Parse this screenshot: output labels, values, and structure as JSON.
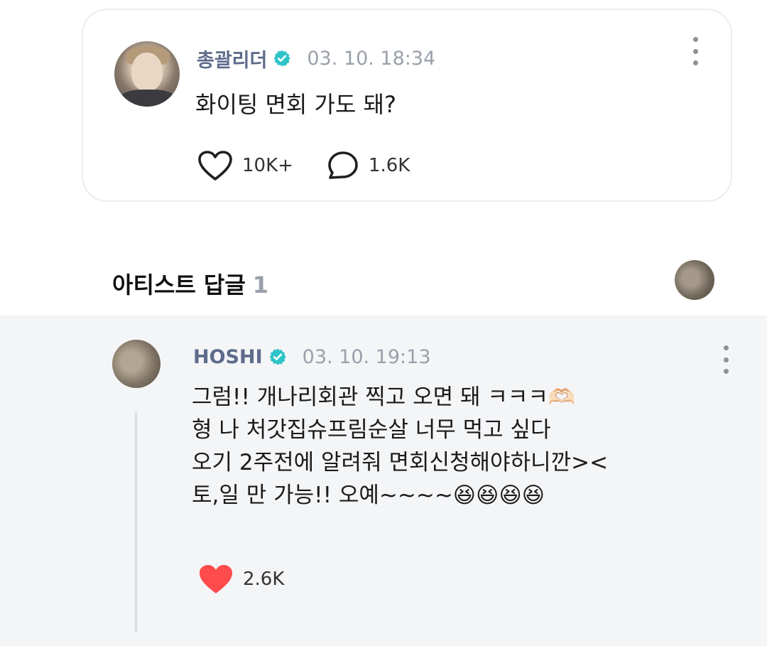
{
  "post": {
    "author": "총괄리더",
    "timestamp": "03. 10. 18:34",
    "text": "화이팅 면회 가도 돼?",
    "likes": "10K+",
    "comments": "1.6K"
  },
  "artist_replies": {
    "title": "아티스트 답글",
    "count": "1"
  },
  "reply": {
    "author": "HOSHI",
    "timestamp": "03. 10. 19:13",
    "lines": [
      "그럼!! 개나리회관 찍고 오면 돼 ㅋㅋㅋ🫶🏻",
      "형 나 처갓집슈프림순살 너무 먹고 싶다",
      "오기 2주전에 알려줘 면회신청해야하니깐><",
      "토,일 만 가능!! 오예~~~~😆😆😆😆"
    ],
    "likes": "2.6K"
  },
  "colors": {
    "accent": "#2fc4c7",
    "like_active": "#ff4b4b",
    "author_name": "#5e6b8a",
    "muted": "#9aa0aa",
    "reply_background": "#f4f5f7"
  },
  "icons": {
    "verified": "verified-badge-icon",
    "like": "heart-icon",
    "comment": "comment-bubble-icon",
    "more": "kebab-menu-icon"
  }
}
